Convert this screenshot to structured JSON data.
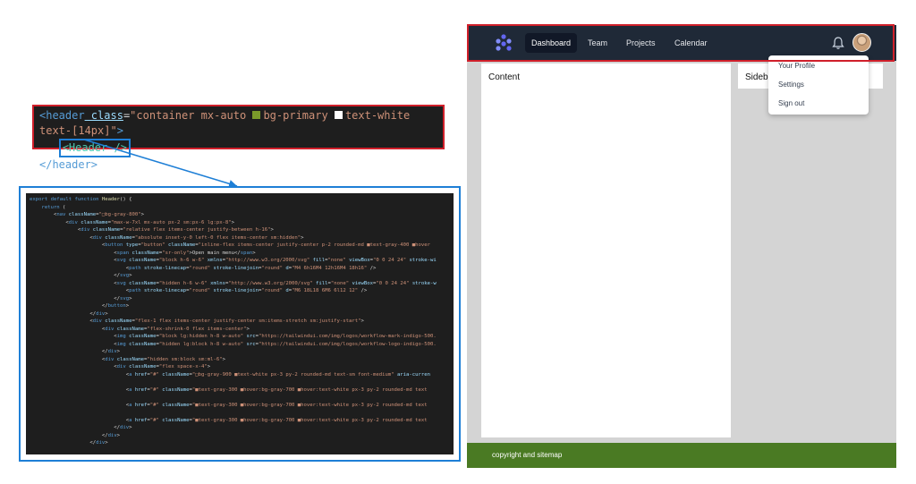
{
  "snippet": {
    "line1_tag_open": "<header",
    "line1_attr": " class",
    "line1_eq": "=",
    "line1_str_a": "\"container mx-auto ",
    "line1_str_b": "bg-primary ",
    "line1_str_c": "text-white text-[14px]\"",
    "line1_close": ">",
    "line2_component": "<Header />",
    "line3": "</header>",
    "colors": {
      "primary_swatch": "#7a9a2a",
      "white_swatch": "#ffffff"
    }
  },
  "code_lines": [
    [
      [
        "k",
        "export default function "
      ],
      [
        "y",
        "Header"
      ],
      [
        "p",
        "() {"
      ]
    ],
    [
      [
        "k",
        "    return "
      ],
      [
        "p",
        "("
      ]
    ],
    [
      [
        "p",
        "        <"
      ],
      [
        "k",
        "nav "
      ],
      [
        "a",
        "className"
      ],
      [
        "p",
        "="
      ],
      [
        "s",
        "\"□bg-gray-800\""
      ],
      [
        "p",
        ">"
      ]
    ],
    [
      [
        "p",
        "            <"
      ],
      [
        "k",
        "div "
      ],
      [
        "a",
        "className"
      ],
      [
        "p",
        "="
      ],
      [
        "s",
        "\"max-w-7xl mx-auto px-2 sm:px-6 lg:px-8\""
      ],
      [
        "p",
        ">"
      ]
    ],
    [
      [
        "p",
        "                <"
      ],
      [
        "k",
        "div "
      ],
      [
        "a",
        "className"
      ],
      [
        "p",
        "="
      ],
      [
        "s",
        "\"relative flex items-center justify-between h-16\""
      ],
      [
        "p",
        ">"
      ]
    ],
    [
      [
        "p",
        "                    <"
      ],
      [
        "k",
        "div "
      ],
      [
        "a",
        "className"
      ],
      [
        "p",
        "="
      ],
      [
        "s",
        "\"absolute inset-y-0 left-0 flex items-center sm:hidden\""
      ],
      [
        "p",
        ">"
      ]
    ],
    [
      [
        "p",
        "                        <"
      ],
      [
        "k",
        "button "
      ],
      [
        "a",
        "type"
      ],
      [
        "p",
        "="
      ],
      [
        "s",
        "\"button\" "
      ],
      [
        "a",
        "className"
      ],
      [
        "p",
        "="
      ],
      [
        "s",
        "\"inline-flex items-center justify-center p-2 rounded-md ■text-gray-400 ■hover"
      ]
    ],
    [
      [
        "p",
        "                            <"
      ],
      [
        "k",
        "span "
      ],
      [
        "a",
        "className"
      ],
      [
        "p",
        "="
      ],
      [
        "s",
        "\"sr-only\""
      ],
      [
        "p",
        ">Open main menu</"
      ],
      [
        "k",
        "span"
      ],
      [
        "p",
        ">"
      ]
    ],
    [
      [
        "p",
        "                            <"
      ],
      [
        "k",
        "svg "
      ],
      [
        "a",
        "className"
      ],
      [
        "p",
        "="
      ],
      [
        "s",
        "\"block h-6 w-6\" "
      ],
      [
        "a",
        "xmlns"
      ],
      [
        "p",
        "="
      ],
      [
        "s",
        "\"http://www.w3.org/2000/svg\" "
      ],
      [
        "a",
        "fill"
      ],
      [
        "p",
        "="
      ],
      [
        "s",
        "\"none\" "
      ],
      [
        "a",
        "viewBox"
      ],
      [
        "p",
        "="
      ],
      [
        "s",
        "\"0 0 24 24\" "
      ],
      [
        "a",
        "stroke-wi"
      ]
    ],
    [
      [
        "p",
        "                                <"
      ],
      [
        "k",
        "path "
      ],
      [
        "a",
        "stroke-linecap"
      ],
      [
        "p",
        "="
      ],
      [
        "s",
        "\"round\" "
      ],
      [
        "a",
        "stroke-linejoin"
      ],
      [
        "p",
        "="
      ],
      [
        "s",
        "\"round\" "
      ],
      [
        "a",
        "d"
      ],
      [
        "p",
        "="
      ],
      [
        "s",
        "\"M4 6h16M4 12h16M4 18h16\" "
      ],
      [
        "p",
        "/>"
      ]
    ],
    [
      [
        "p",
        "                            </"
      ],
      [
        "k",
        "svg"
      ],
      [
        "p",
        ">"
      ]
    ],
    [
      [
        "p",
        "                            <"
      ],
      [
        "k",
        "svg "
      ],
      [
        "a",
        "className"
      ],
      [
        "p",
        "="
      ],
      [
        "s",
        "\"hidden h-6 w-6\" "
      ],
      [
        "a",
        "xmlns"
      ],
      [
        "p",
        "="
      ],
      [
        "s",
        "\"http://www.w3.org/2000/svg\" "
      ],
      [
        "a",
        "fill"
      ],
      [
        "p",
        "="
      ],
      [
        "s",
        "\"none\" "
      ],
      [
        "a",
        "viewBox"
      ],
      [
        "p",
        "="
      ],
      [
        "s",
        "\"0 0 24 24\" "
      ],
      [
        "a",
        "stroke-w"
      ]
    ],
    [
      [
        "p",
        "                                <"
      ],
      [
        "k",
        "path "
      ],
      [
        "a",
        "stroke-linecap"
      ],
      [
        "p",
        "="
      ],
      [
        "s",
        "\"round\" "
      ],
      [
        "a",
        "stroke-linejoin"
      ],
      [
        "p",
        "="
      ],
      [
        "s",
        "\"round\" "
      ],
      [
        "a",
        "d"
      ],
      [
        "p",
        "="
      ],
      [
        "s",
        "\"M6 18L18 6M6 6l12 12\" "
      ],
      [
        "p",
        "/>"
      ]
    ],
    [
      [
        "p",
        "                            </"
      ],
      [
        "k",
        "svg"
      ],
      [
        "p",
        ">"
      ]
    ],
    [
      [
        "p",
        "                        </"
      ],
      [
        "k",
        "button"
      ],
      [
        "p",
        ">"
      ]
    ],
    [
      [
        "p",
        "                    </"
      ],
      [
        "k",
        "div"
      ],
      [
        "p",
        ">"
      ]
    ],
    [
      [
        "p",
        "                    <"
      ],
      [
        "k",
        "div "
      ],
      [
        "a",
        "className"
      ],
      [
        "p",
        "="
      ],
      [
        "s",
        "\"flex-1 flex items-center justify-center sm:items-stretch sm:justify-start\""
      ],
      [
        "p",
        ">"
      ]
    ],
    [
      [
        "p",
        "                        <"
      ],
      [
        "k",
        "div "
      ],
      [
        "a",
        "className"
      ],
      [
        "p",
        "="
      ],
      [
        "s",
        "\"flex-shrink-0 flex items-center\""
      ],
      [
        "p",
        ">"
      ]
    ],
    [
      [
        "p",
        "                            <"
      ],
      [
        "k",
        "img "
      ],
      [
        "a",
        "className"
      ],
      [
        "p",
        "="
      ],
      [
        "s",
        "\"block lg:hidden h-8 w-auto\" "
      ],
      [
        "a",
        "src"
      ],
      [
        "p",
        "="
      ],
      [
        "s",
        "\"https://tailwindui.com/img/logos/workflow-mark-indigo-500."
      ]
    ],
    [
      [
        "p",
        "                            <"
      ],
      [
        "k",
        "img "
      ],
      [
        "a",
        "className"
      ],
      [
        "p",
        "="
      ],
      [
        "s",
        "\"hidden lg:block h-8 w-auto\" "
      ],
      [
        "a",
        "src"
      ],
      [
        "p",
        "="
      ],
      [
        "s",
        "\"https://tailwindui.com/img/logos/workflow-logo-indigo-500."
      ]
    ],
    [
      [
        "p",
        "                        </"
      ],
      [
        "k",
        "div"
      ],
      [
        "p",
        ">"
      ]
    ],
    [
      [
        "p",
        "                        <"
      ],
      [
        "k",
        "div "
      ],
      [
        "a",
        "className"
      ],
      [
        "p",
        "="
      ],
      [
        "s",
        "\"hidden sm:block sm:ml-6\""
      ],
      [
        "p",
        ">"
      ]
    ],
    [
      [
        "p",
        "                            <"
      ],
      [
        "k",
        "div "
      ],
      [
        "a",
        "className"
      ],
      [
        "p",
        "="
      ],
      [
        "s",
        "\"flex space-x-4\""
      ],
      [
        "p",
        ">"
      ]
    ],
    [
      [
        "p",
        "                                <"
      ],
      [
        "k",
        "a "
      ],
      [
        "a",
        "href"
      ],
      [
        "p",
        "="
      ],
      [
        "s",
        "\"#\" "
      ],
      [
        "a",
        "className"
      ],
      [
        "p",
        "="
      ],
      [
        "s",
        "\"□bg-gray-900 ■text-white px-3 py-2 rounded-md text-sm font-medium\" "
      ],
      [
        "a",
        "aria-curren"
      ]
    ],
    [
      [
        "p",
        " "
      ]
    ],
    [
      [
        "p",
        "                                <"
      ],
      [
        "k",
        "a "
      ],
      [
        "a",
        "href"
      ],
      [
        "p",
        "="
      ],
      [
        "s",
        "\"#\" "
      ],
      [
        "a",
        "className"
      ],
      [
        "p",
        "="
      ],
      [
        "s",
        "\"■text-gray-300 ■hover:bg-gray-700 ■hover:text-white px-3 py-2 rounded-md text"
      ]
    ],
    [
      [
        "p",
        " "
      ]
    ],
    [
      [
        "p",
        "                                <"
      ],
      [
        "k",
        "a "
      ],
      [
        "a",
        "href"
      ],
      [
        "p",
        "="
      ],
      [
        "s",
        "\"#\" "
      ],
      [
        "a",
        "className"
      ],
      [
        "p",
        "="
      ],
      [
        "s",
        "\"■text-gray-300 ■hover:bg-gray-700 ■hover:text-white px-3 py-2 rounded-md text"
      ]
    ],
    [
      [
        "p",
        " "
      ]
    ],
    [
      [
        "p",
        "                                <"
      ],
      [
        "k",
        "a "
      ],
      [
        "a",
        "href"
      ],
      [
        "p",
        "="
      ],
      [
        "s",
        "\"#\" "
      ],
      [
        "a",
        "className"
      ],
      [
        "p",
        "="
      ],
      [
        "s",
        "\"■text-gray-300 ■hover:bg-gray-700 ■hover:text-white px-3 py-2 rounded-md text"
      ]
    ],
    [
      [
        "p",
        "                            </"
      ],
      [
        "k",
        "div"
      ],
      [
        "p",
        ">"
      ]
    ],
    [
      [
        "p",
        "                        </"
      ],
      [
        "k",
        "div"
      ],
      [
        "p",
        ">"
      ]
    ],
    [
      [
        "p",
        "                    </"
      ],
      [
        "k",
        "div"
      ],
      [
        "p",
        ">"
      ]
    ]
  ],
  "app": {
    "nav": {
      "items": [
        "Dashboard",
        "Team",
        "Projects",
        "Calendar"
      ],
      "logo_icon": "workflow-logo-icon",
      "bell_icon": "bell-icon",
      "colors": {
        "nav_bg": "#1f2937",
        "active_bg": "#111827",
        "logo": "#6366f1"
      }
    },
    "content_title": "Content",
    "sidebar_title": "Sideba",
    "dropdown": [
      "Your Profile",
      "Settings",
      "Sign out"
    ],
    "footer_text": "copyright and sitemap",
    "colors": {
      "page_bg": "#d4d4d4",
      "footer_bg": "#4a7a23"
    }
  },
  "annotation_colors": {
    "red": "#d01f2a",
    "blue": "#1e7fd6"
  }
}
